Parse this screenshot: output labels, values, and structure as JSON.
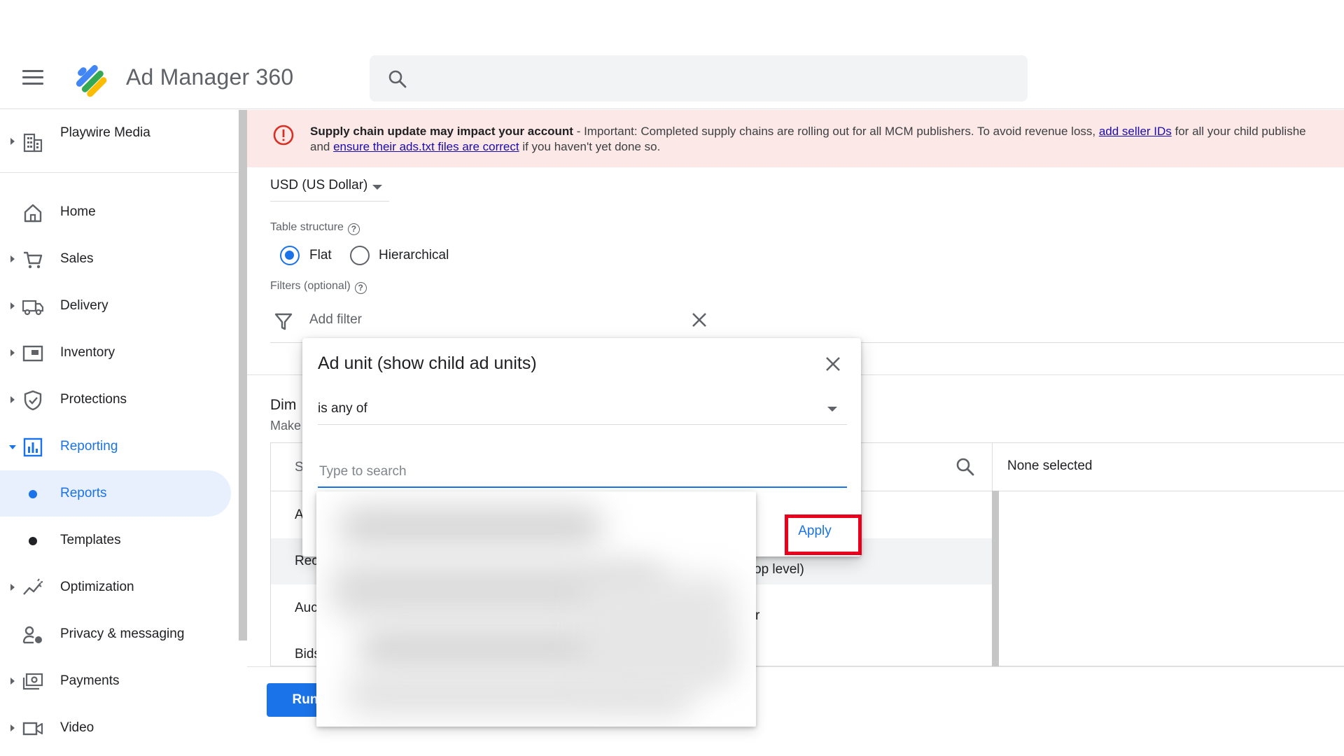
{
  "header": {
    "app_title": "Ad Manager 360"
  },
  "sidebar": {
    "account_name": "Playwire Media",
    "items": [
      {
        "label": "Home"
      },
      {
        "label": "Sales"
      },
      {
        "label": "Delivery"
      },
      {
        "label": "Inventory"
      },
      {
        "label": "Protections"
      },
      {
        "label": "Reporting"
      },
      {
        "label": "Reports"
      },
      {
        "label": "Templates"
      },
      {
        "label": "Optimization"
      },
      {
        "label": "Privacy & messaging"
      },
      {
        "label": "Payments"
      },
      {
        "label": "Video"
      }
    ]
  },
  "banner": {
    "title": "Supply chain update may impact your account",
    "text_1": " - Important: Completed supply chains are rolling out for all MCM publishers. To avoid revenue loss, ",
    "link_1": "add seller IDs",
    "text_2": " for all your child publishe",
    "text_3": "and ",
    "link_2": "ensure their ads.txt files are correct",
    "text_4": " if you haven't yet done so."
  },
  "form": {
    "currency": "USD (US Dollar)",
    "table_structure_label": "Table structure",
    "option_flat": "Flat",
    "option_hierarchical": "Hierarchical",
    "filters_label": "Filters (optional)",
    "add_filter_placeholder": "Add filter",
    "dimensions_title": "Dim",
    "dimensions_sub": "Make"
  },
  "dimension_table": {
    "search_stub": "S",
    "none_selected": "None selected",
    "left_cells": [
      "A",
      "Rec",
      "Auc",
      "Bids"
    ],
    "right_cells": [
      "op level)",
      "r"
    ]
  },
  "run_label": "Run",
  "dialog": {
    "title": "Ad unit (show child ad units)",
    "operator": "is any of",
    "search_placeholder": "Type to search",
    "apply_label": "Apply"
  },
  "colors": {
    "accent": "#1a73e8",
    "banner_bg": "#fce8e6",
    "alert": "#d93025",
    "highlight": "#e8001c"
  }
}
